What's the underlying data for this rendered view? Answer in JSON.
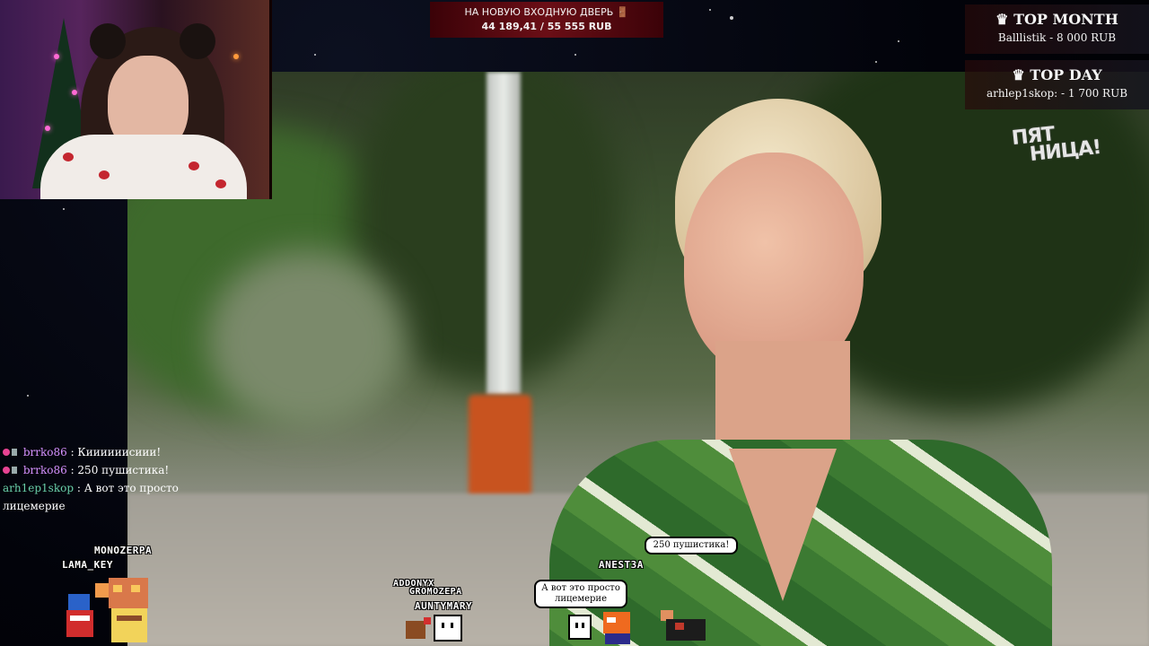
{
  "goal": {
    "title": "НА НОВУЮ ВХОДНУЮ ДВЕРЬ 🚪",
    "progress": "44 189,41 / 55 555 RUB"
  },
  "top_month": {
    "title": "TOP MONTH",
    "value": "Balllistik - 8 000 RUB"
  },
  "top_day": {
    "title": "TOP DAY",
    "value": "arhlep1skop: - 1 700 RUB"
  },
  "channel_logo": {
    "line1": "ПЯТ",
    "line2": "НИЦА!"
  },
  "chat": [
    {
      "user": "brrko86",
      "message": "Киииииисиии!"
    },
    {
      "user": "brrko86",
      "message": "250 пушистика!"
    },
    {
      "user": "arh1ep1skop",
      "message": "А вот это просто",
      "message2": "лицемерие"
    }
  ],
  "avatars": {
    "names": [
      "MONOZERPA",
      "LAMA_KEY",
      "ADDONYX",
      "GROMOZEPA",
      "AUNTYMARY",
      "ANEST3A"
    ],
    "bubble1": "250 пушистика!",
    "bubble2_line1": "А вот это просто",
    "bubble2_line2": "лицемерие"
  },
  "colors": {
    "goal_bg": "#6b0e16",
    "chat_user1": "#d792ff",
    "chat_user2": "#6ad0a9"
  }
}
